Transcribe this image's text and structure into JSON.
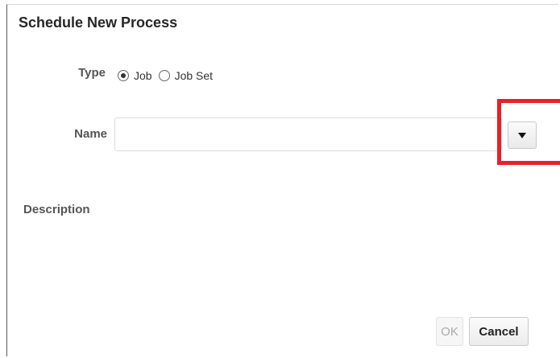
{
  "dialog": {
    "title": "Schedule New Process"
  },
  "type_field": {
    "label": "Type",
    "options": [
      {
        "label": "Job",
        "selected": true
      },
      {
        "label": "Job Set",
        "selected": false
      }
    ]
  },
  "name_field": {
    "label": "Name",
    "value": "",
    "placeholder": ""
  },
  "description_field": {
    "label": "Description"
  },
  "buttons": {
    "ok_label": "OK",
    "cancel_label": "Cancel"
  },
  "icons": {
    "dropdown": "chevron-down-icon"
  },
  "colors": {
    "highlight": "#e8202a"
  }
}
